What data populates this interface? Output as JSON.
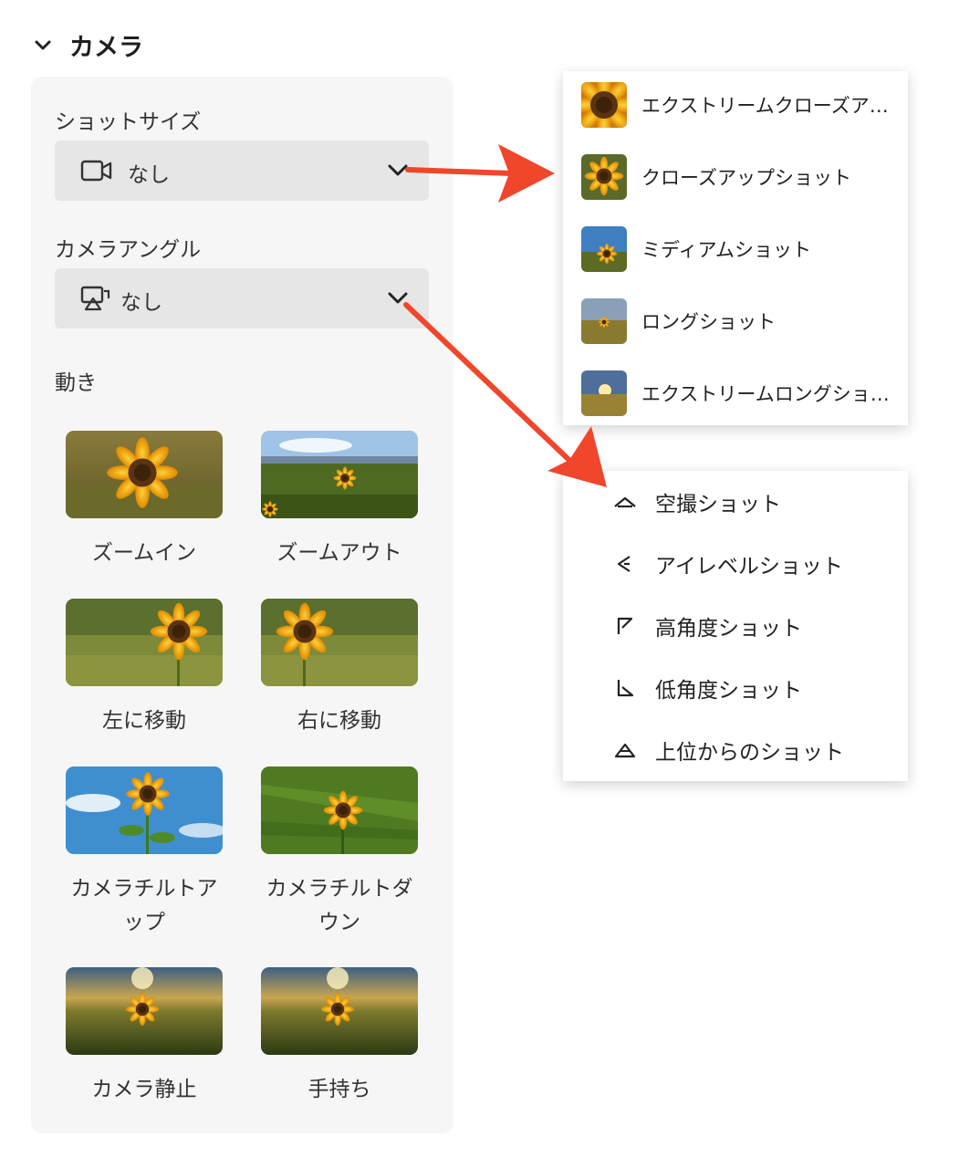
{
  "section": {
    "title": "カメラ",
    "icon": "chevron-down-icon"
  },
  "shot_size": {
    "label": "ショットサイズ",
    "value": "なし",
    "icon": "video-camera-icon"
  },
  "camera_angle": {
    "label": "カメラアングル",
    "value": "なし",
    "icon": "camera-angle-icon"
  },
  "movement": {
    "label": "動き",
    "items": [
      {
        "label": "ズームイン"
      },
      {
        "label": "ズームアウト"
      },
      {
        "label": "左に移動"
      },
      {
        "label": "右に移動"
      },
      {
        "label": "カメラチルトアップ"
      },
      {
        "label": "カメラチルトダウン"
      },
      {
        "label": "カメラ静止"
      },
      {
        "label": "手持ち"
      }
    ]
  },
  "shot_size_menu": {
    "items": [
      {
        "label": "エクストリームクローズアップショット"
      },
      {
        "label": "クローズアップショット"
      },
      {
        "label": "ミディアムショット"
      },
      {
        "label": "ロングショット"
      },
      {
        "label": "エクストリームロングショット"
      }
    ]
  },
  "angle_menu": {
    "items": [
      {
        "label": "空撮ショット",
        "icon": "aerial-angle-icon"
      },
      {
        "label": "アイレベルショット",
        "icon": "eye-level-angle-icon"
      },
      {
        "label": "高角度ショット",
        "icon": "high-angle-icon"
      },
      {
        "label": "低角度ショット",
        "icon": "low-angle-icon"
      },
      {
        "label": "上位からのショット",
        "icon": "overhead-angle-icon"
      }
    ]
  },
  "colors": {
    "arrow": "#f0462c",
    "panel": "#f6f6f6",
    "select": "#e6e6e6"
  }
}
